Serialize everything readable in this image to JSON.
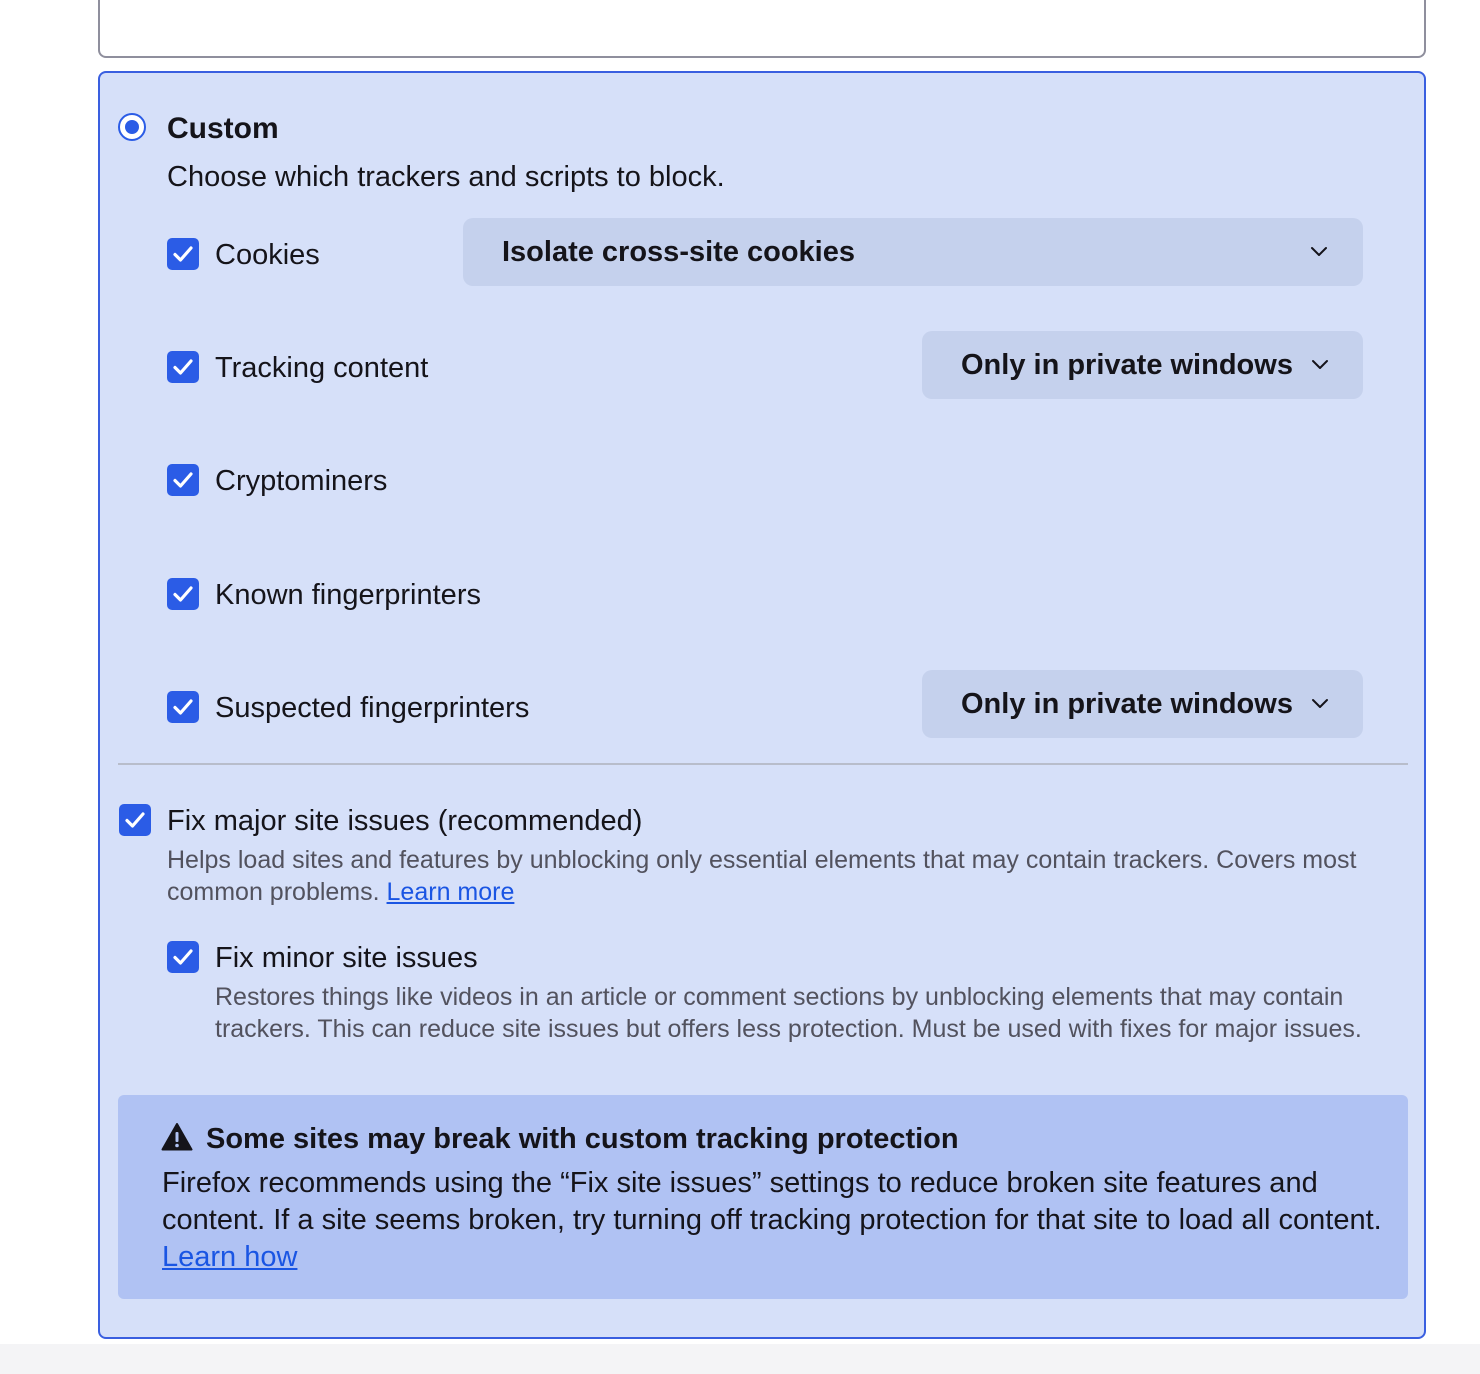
{
  "custom": {
    "title": "Custom",
    "description": "Choose which trackers and scripts to block.",
    "selected": true
  },
  "trackers": {
    "cookies": {
      "label": "Cookies",
      "checked": true,
      "select_value": "Isolate cross-site cookies"
    },
    "tracking_content": {
      "label": "Tracking content",
      "checked": true,
      "select_value": "Only in private windows"
    },
    "cryptominers": {
      "label": "Cryptominers",
      "checked": true
    },
    "known_fingerprinters": {
      "label": "Known fingerprinters",
      "checked": true
    },
    "suspected_fingerprinters": {
      "label": "Suspected fingerprinters",
      "checked": true,
      "select_value": "Only in private windows"
    }
  },
  "fix_major": {
    "label": "Fix major site issues (recommended)",
    "checked": true,
    "description": "Helps load sites and features by unblocking only essential elements that may contain trackers. Covers most common problems.",
    "link": "Learn more"
  },
  "fix_minor": {
    "label": "Fix minor site issues",
    "checked": true,
    "description": "Restores things like videos in an article or comment sections by unblocking elements that may contain trackers. This can reduce site issues but offers less protection. Must be used with fixes for major issues."
  },
  "warning": {
    "icon": "warning-triangle-icon",
    "title": "Some sites may break with custom tracking protection",
    "body": "Firefox recommends using the “Fix site issues” settings to reduce broken site features and content. If a site seems broken, try turning off tracking protection for that site to load all content.",
    "link": "Learn how"
  },
  "colors": {
    "accent": "#2b5ce6",
    "card_background": "#d6e0f9",
    "warning_background": "#b0c2f3",
    "link": "#1a55e3"
  }
}
